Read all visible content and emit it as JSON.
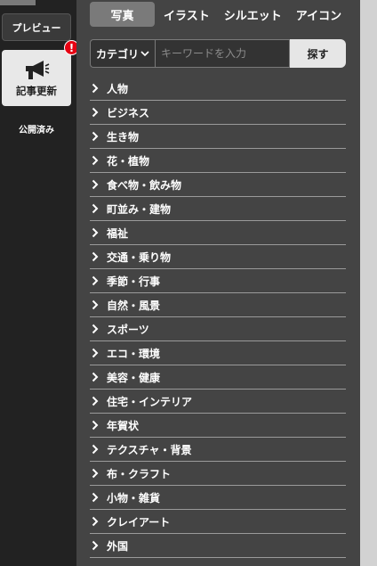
{
  "sidebar": {
    "preview_label": "プレビュー",
    "update_label": "記事更新",
    "alert_mark": "!",
    "published_label": "公開済み",
    "update_icon": "megaphone-icon",
    "colors": {
      "background": "#222222",
      "alert": "#e60012"
    }
  },
  "tabs": [
    {
      "label": "写真",
      "active": true
    },
    {
      "label": "イラスト",
      "active": false
    },
    {
      "label": "シルエット",
      "active": false
    },
    {
      "label": "アイコン",
      "active": false
    }
  ],
  "search": {
    "category_label": "カテゴリ",
    "placeholder": "キーワードを入力",
    "value": "",
    "button_label": "探す"
  },
  "categories": [
    "人物",
    "ビジネス",
    "生き物",
    "花・植物",
    "食べ物・飲み物",
    "町並み・建物",
    "福祉",
    "交通・乗り物",
    "季節・行事",
    "自然・風景",
    "スポーツ",
    "エコ・環境",
    "美容・健康",
    "住宅・インテリア",
    "年賀状",
    "テクスチャ・背景",
    "布・クラフト",
    "小物・雑貨",
    "クレイアート",
    "外国"
  ],
  "colors": {
    "panel": "#444444",
    "active_tab": "#7a7a7a",
    "divider": "#9a9a9a"
  }
}
